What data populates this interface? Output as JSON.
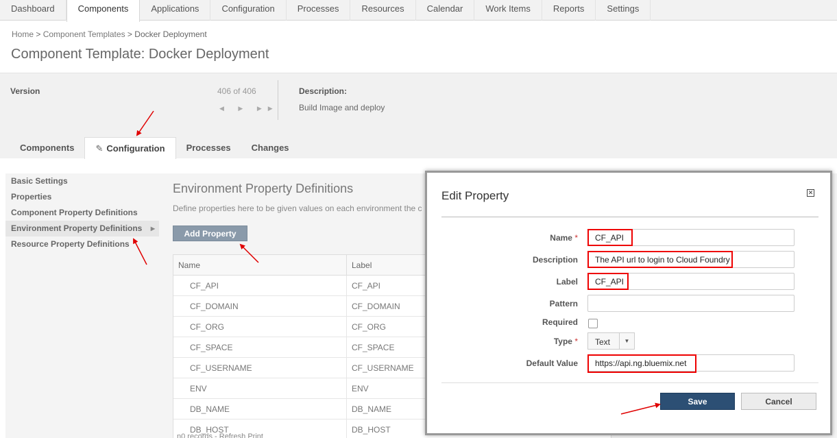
{
  "topnav": {
    "items": [
      "Dashboard",
      "Components",
      "Applications",
      "Configuration",
      "Processes",
      "Resources",
      "Calendar",
      "Work Items",
      "Reports",
      "Settings"
    ],
    "active_index": 1
  },
  "breadcrumb": {
    "home": "Home",
    "sep": ">",
    "parent": "Component Templates",
    "current": "Docker Deployment"
  },
  "page_title": "Component Template: Docker Deployment",
  "version": {
    "label": "Version",
    "count": "406 of 406",
    "nav": "◀ ▶ ▶▶",
    "description_label": "Description:",
    "description": "Build Image and deploy"
  },
  "tabs": {
    "components": "Components",
    "configuration": "Configuration",
    "processes": "Processes",
    "changes": "Changes"
  },
  "sidenav": {
    "items": [
      "Basic Settings",
      "Properties",
      "Component Property Definitions",
      "Environment Property Definitions",
      "Resource Property Definitions"
    ],
    "active_index": 3,
    "arrow": "▶"
  },
  "main": {
    "title": "Environment Property Definitions",
    "description": "Define properties here to be given values on each environment the c",
    "add_button": "Add Property",
    "columns": {
      "name": "Name",
      "label": "Label"
    },
    "rows": [
      {
        "name": "CF_API",
        "label": "CF_API"
      },
      {
        "name": "CF_DOMAIN",
        "label": "CF_DOMAIN"
      },
      {
        "name": "CF_ORG",
        "label": "CF_ORG"
      },
      {
        "name": "CF_SPACE",
        "label": "CF_SPACE"
      },
      {
        "name": "CF_USERNAME",
        "label": "CF_USERNAME"
      },
      {
        "name": "ENV",
        "label": "ENV"
      },
      {
        "name": "DB_NAME",
        "label": "DB_NAME"
      },
      {
        "name": "DB_HOST",
        "label": "DB_HOST"
      }
    ],
    "footer": "n0 records  -  Refresh  Print"
  },
  "modal": {
    "title": "Edit Property",
    "close": "✕",
    "fields": {
      "name_label": "Name",
      "name_value": "CF_API",
      "description_label": "Description",
      "description_value": "The API url to login to Cloud Foundry",
      "label_label": "Label",
      "label_value": "CF_API",
      "pattern_label": "Pattern",
      "pattern_value": "",
      "required_label": "Required",
      "type_label": "Type",
      "type_value": "Text",
      "default_label": "Default Value",
      "default_value": "https://api.ng.bluemix.net"
    },
    "required_marker": "*",
    "save": "Save",
    "cancel": "Cancel"
  },
  "colors": {
    "annotation": "#e00000",
    "primary_button": "#2c4f74",
    "add_button": "#8a9aaa"
  }
}
